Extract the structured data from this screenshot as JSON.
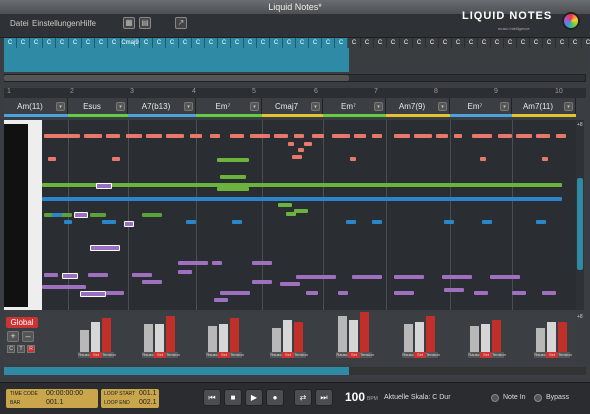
{
  "window": {
    "title": "Liquid Notes*"
  },
  "menu": [
    "Datei",
    "Einstellungen",
    "Hilfe"
  ],
  "logo": {
    "text": "LIQUID NOTES",
    "sub": "music intelligence"
  },
  "overview_cells": [
    "C",
    "C",
    "C",
    "C",
    "C",
    "C",
    "C",
    "C",
    "C",
    "Cmaj9",
    "C",
    "C",
    "C",
    "C",
    "C",
    "C",
    "C",
    "C",
    "C",
    "C",
    "C",
    "C",
    "C",
    "C",
    "C",
    "C",
    "C",
    "C",
    "C",
    "C",
    "C",
    "C",
    "C",
    "C",
    "C",
    "C",
    "C",
    "C",
    "C",
    "C",
    "C",
    "C",
    "C",
    "C",
    "C"
  ],
  "ruler": [
    "1",
    "2",
    "3",
    "4",
    "5",
    "6",
    "7",
    "8",
    "9",
    "10"
  ],
  "chords": [
    {
      "label": "Am(11)",
      "strip": "#4aa3df"
    },
    {
      "label": "Esus",
      "strip": "#6c4"
    },
    {
      "label": "A7(b13)",
      "strip": "#4aa3df"
    },
    {
      "label": "Em⁷",
      "strip": "#6c4"
    },
    {
      "label": "Cmaj7",
      "strip": "#e6c230"
    },
    {
      "label": "Em⁷",
      "strip": "#6c4"
    },
    {
      "label": "Am7(9)",
      "strip": "#e6c230"
    },
    {
      "label": "Em⁷",
      "strip": "#4aa3df"
    },
    {
      "label": "Am7(11)",
      "strip": "#e6c230"
    }
  ],
  "right_marker": "+8",
  "bottom": {
    "global": "Global",
    "plus": "+",
    "minus": "–",
    "modes": [
      "C",
      "T",
      "R"
    ],
    "group_labels": [
      "Rausc",
      "Set",
      "Tension"
    ],
    "marker": "+8"
  },
  "transport": {
    "time_code_label": "TIME CODE",
    "time_code_value": "00:00:00:00",
    "bar_label": "BAR",
    "bar_value": "001.1",
    "loop_start_label": "LOOP START",
    "loop_start_value": "001.1",
    "loop_end_label": "LOOP END",
    "loop_end_value": "002.1",
    "tempo": "100",
    "bpm_label": "BPM",
    "scale": "Aktuelle Skala: C Dur",
    "note_in": "Note In",
    "bypass": "Bypass"
  }
}
